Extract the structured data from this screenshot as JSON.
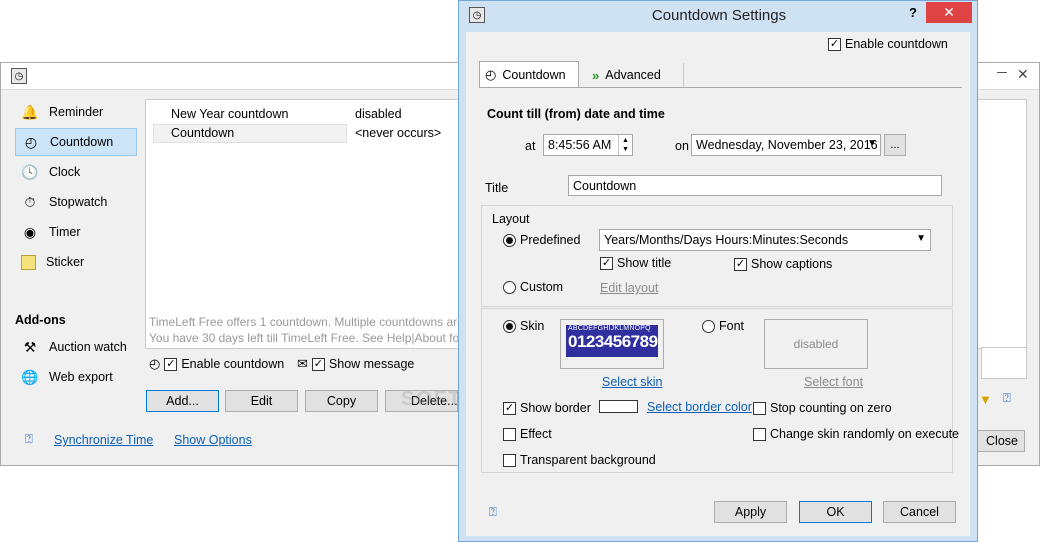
{
  "main": {
    "sidebar": {
      "items": [
        {
          "label": "Reminder",
          "icon": "bell-icon"
        },
        {
          "label": "Countdown",
          "icon": "countdown-clock-icon"
        },
        {
          "label": "Clock",
          "icon": "clock-icon"
        },
        {
          "label": "Stopwatch",
          "icon": "stopwatch-icon"
        },
        {
          "label": "Timer",
          "icon": "timer-icon"
        },
        {
          "label": "Sticker",
          "icon": "sticker-icon"
        }
      ],
      "addons_heading": "Add-ons",
      "addons": [
        {
          "label": "Auction watch",
          "icon": "gavel-icon"
        },
        {
          "label": "Web export",
          "icon": "globe-icon"
        }
      ]
    },
    "list": [
      {
        "name": "New Year countdown",
        "status": "disabled"
      },
      {
        "name": "Countdown",
        "status": "<never occurs>"
      }
    ],
    "notice_line1": "TimeLeft Free offers 1 countdown. Multiple countdowns ar",
    "notice_line2": "You have 30 days left till TimeLeft Free. See Help|About for",
    "enable_countdown": "Enable countdown",
    "show_message": "Show message",
    "buttons": {
      "add": "Add...",
      "edit": "Edit",
      "copy": "Copy",
      "delete": "Delete...",
      "close": "Close"
    },
    "links": {
      "sync": "Synchronize Time",
      "show_options": "Show Options"
    },
    "watermark": "SOFTPEDIA"
  },
  "dialog": {
    "title": "Countdown Settings",
    "help_glyph": "?",
    "close_glyph": "✕",
    "enable_countdown": "Enable countdown",
    "tabs": [
      {
        "label": "Countdown",
        "icon": "countdown-clock-icon"
      },
      {
        "label": "Advanced",
        "icon": "double-chevron-icon"
      }
    ],
    "section_heading": "Count till (from) date and time",
    "at_label": "at",
    "time_value": "8:45:56 AM",
    "on_label": "on",
    "date_value": "Wednesday, November 23, 2016",
    "ellipsis": "...",
    "title_label": "Title",
    "title_value": "Countdown",
    "layout_heading": "Layout",
    "predefined_label": "Predefined",
    "predefined_value": "Years/Months/Days Hours:Minutes:Seconds",
    "show_title": "Show title",
    "show_captions": "Show captions",
    "custom_label": "Custom",
    "edit_layout": "Edit layout",
    "skin_label": "Skin",
    "skin_preview_top": "ABCDEFGHIJKLMNOPQ",
    "skin_preview_digits": "0123456789",
    "select_skin": "Select skin",
    "font_label": "Font",
    "font_preview": "disabled",
    "select_font": "Select font",
    "show_border": "Show border",
    "select_border_color": "Select border color",
    "stop_counting": "Stop counting on zero",
    "effect": "Effect",
    "change_skin": "Change skin randomly on execute",
    "transparent_bg": "Transparent background",
    "buttons": {
      "apply": "Apply",
      "ok": "OK",
      "cancel": "Cancel"
    }
  },
  "colors": {
    "selection": "#cce4f7",
    "link": "#0b5fb8",
    "skin_bg": "#2f2fa0",
    "dialog_frame": "#cfe2f3"
  }
}
